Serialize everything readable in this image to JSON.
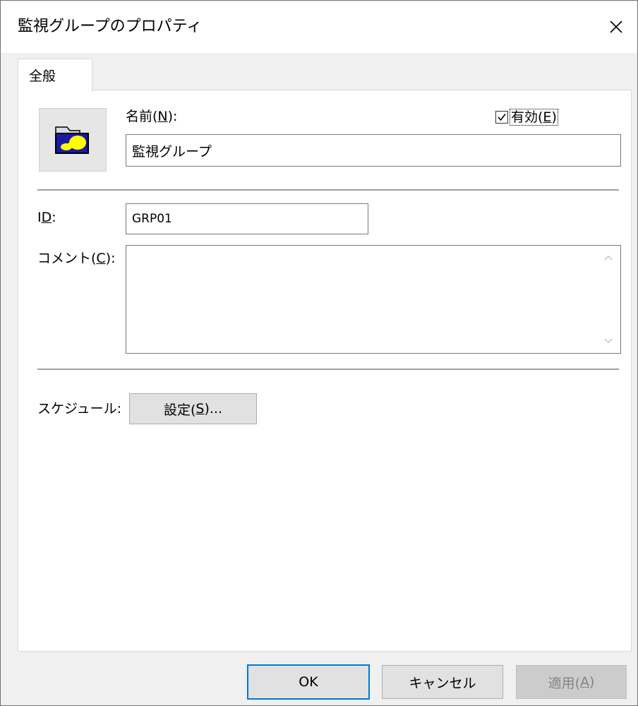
{
  "window": {
    "title": "監視グループのプロパティ",
    "close_icon": "close-icon"
  },
  "tabs": [
    {
      "label": "全般",
      "selected": true
    }
  ],
  "general": {
    "folder_icon": "folder-icon",
    "name_label_prefix": "名前(",
    "name_label_key": "N",
    "name_label_suffix": "):",
    "name_value": "監視グループ",
    "enabled_label_prefix": "有効(",
    "enabled_label_key": "E",
    "enabled_label_suffix": ")",
    "enabled_checked": true,
    "id_label_prefix": "I",
    "id_label_key": "D",
    "id_label_suffix": ":",
    "id_value": "GRP01",
    "comment_label_prefix": "コメント(",
    "comment_label_key": "C",
    "comment_label_suffix": "):",
    "comment_value": "",
    "schedule_label": "スケジュール:",
    "schedule_button_prefix": "設定(",
    "schedule_button_key": "S",
    "schedule_button_suffix": ")..."
  },
  "footer": {
    "ok_label": "OK",
    "cancel_label": "キャンセル",
    "apply_label_prefix": "適用(",
    "apply_label_key": "A",
    "apply_label_suffix": ")",
    "apply_enabled": false
  },
  "colors": {
    "accent": "#0078d7",
    "dialog_bg": "#f0f0f0",
    "panel_bg": "#ffffff",
    "button_bg": "#e1e1e1",
    "disabled_text": "#838383",
    "folder_blue": "#1a1aa0",
    "folder_yellow": "#ffff00"
  }
}
